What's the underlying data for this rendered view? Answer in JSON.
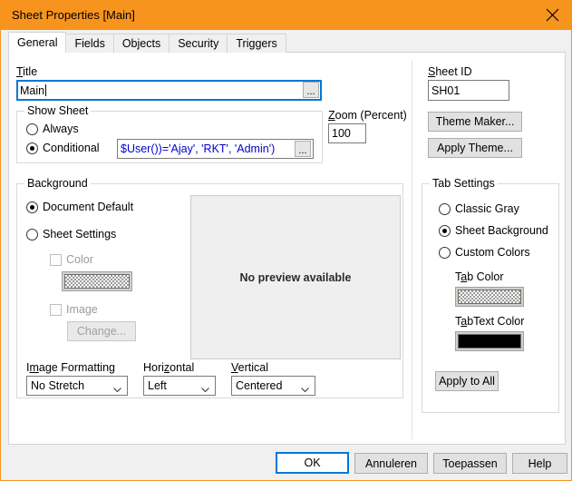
{
  "window": {
    "title": "Sheet Properties [Main]",
    "close_icon": "close-icon",
    "titlebar_color": "#f7941e"
  },
  "tabs": [
    {
      "label": "General",
      "active": true
    },
    {
      "label": "Fields",
      "active": false
    },
    {
      "label": "Objects",
      "active": false
    },
    {
      "label": "Security",
      "active": false
    },
    {
      "label": "Triggers",
      "active": false
    }
  ],
  "general": {
    "title_label": "Title",
    "title_value": "Main",
    "title_ellipsis": "...",
    "show_sheet": {
      "group_label": "Show Sheet",
      "always_label": "Always",
      "conditional_label": "Conditional",
      "selected": "Conditional",
      "expression_value": "$User())='Ajay', 'RKT', 'Admin')",
      "expression_ellipsis": "..."
    },
    "zoom": {
      "label": "Zoom (Percent)",
      "value": "100"
    },
    "sheet_id": {
      "label": "Sheet ID",
      "value": "SH01"
    },
    "theme_maker_button": "Theme Maker...",
    "apply_theme_button": "Apply Theme...",
    "background": {
      "group_label": "Background",
      "document_default_label": "Document Default",
      "sheet_settings_label": "Sheet Settings",
      "selected": "Document Default",
      "color_label": "Color",
      "color_checked": false,
      "color_swatch": "checkered",
      "image_label": "Image",
      "image_checked": false,
      "change_button": "Change..."
    },
    "preview": {
      "text": "No preview available"
    },
    "image_formatting": {
      "label": "Image Formatting",
      "value": "No Stretch"
    },
    "horizontal": {
      "label": "Horizontal",
      "value": "Left"
    },
    "vertical": {
      "label": "Vertical",
      "value": "Centered"
    },
    "tab_settings": {
      "group_label": "Tab Settings",
      "classic_gray_label": "Classic Gray",
      "sheet_background_label": "Sheet Background",
      "custom_colors_label": "Custom Colors",
      "selected": "Sheet Background",
      "tab_color_label": "Tab Color",
      "tab_color_swatch": "checkered",
      "tab_text_color_label": "TabText Color",
      "tab_text_color_value": "#000000",
      "apply_to_all_button": "Apply to All"
    }
  },
  "footer": {
    "ok_button": "OK",
    "cancel_button": "Annuleren",
    "apply_button": "Toepassen",
    "help_button": "Help"
  }
}
